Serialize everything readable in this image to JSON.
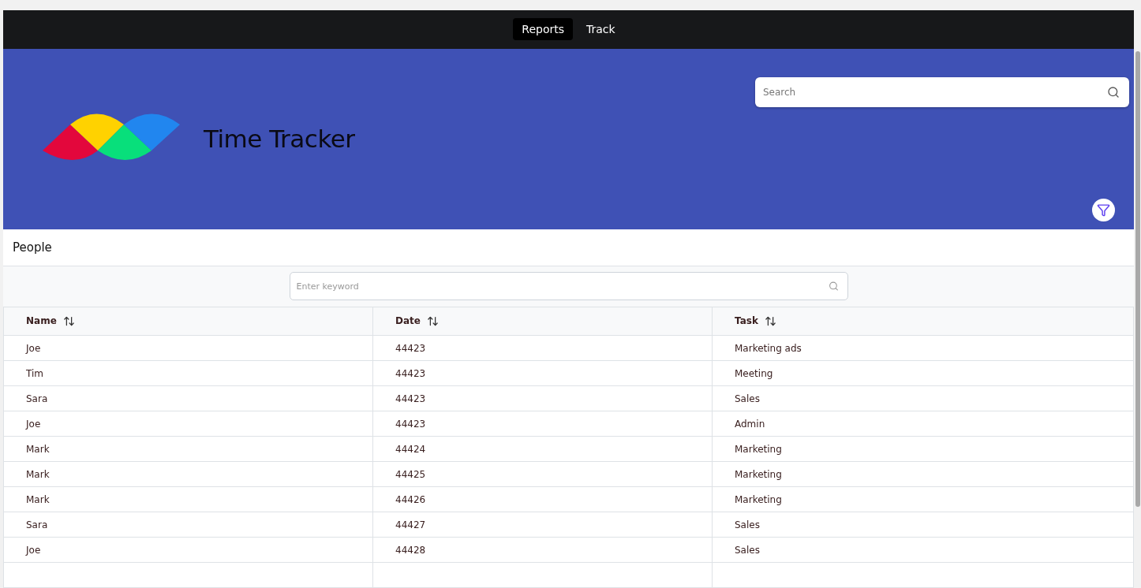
{
  "nav": {
    "tabs": [
      {
        "label": "Reports",
        "selected": true
      },
      {
        "label": "Track",
        "selected": false
      }
    ]
  },
  "header": {
    "title": "Time Tracker",
    "search": {
      "placeholder": "Search"
    }
  },
  "panel": {
    "title": "People",
    "filter": {
      "placeholder": "Enter keyword"
    }
  },
  "table": {
    "columns": [
      "Name",
      "Date",
      "Task"
    ],
    "rows": [
      [
        "Joe",
        "44423",
        "Marketing ads"
      ],
      [
        "Tim",
        "44423",
        "Meeting"
      ],
      [
        "Sara",
        "44423",
        "Sales"
      ],
      [
        "Joe",
        "44423",
        "Admin"
      ],
      [
        "Mark",
        "44424",
        "Marketing"
      ],
      [
        "Mark",
        "44425",
        "Marketing"
      ],
      [
        "Mark",
        "44426",
        "Marketing"
      ],
      [
        "Sara",
        "44427",
        "Sales"
      ],
      [
        "Joe",
        "44428",
        "Sales"
      ]
    ]
  }
}
